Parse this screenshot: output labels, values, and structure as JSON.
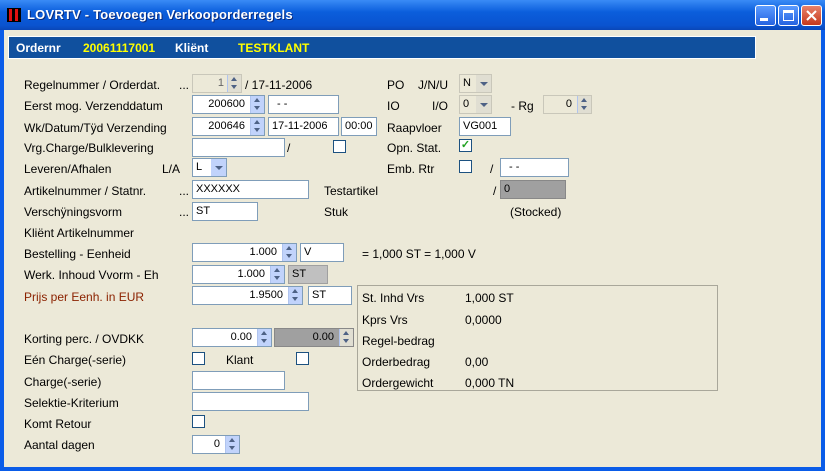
{
  "window": {
    "title": "LOVRTV - Toevoegen Verkooporderregels"
  },
  "header": {
    "ordernr_label": "Ordernr",
    "ordernr_value": "20061117001",
    "client_label": "Kliënt",
    "client_value": "TESTKLANT"
  },
  "fields": {
    "regelnummer": {
      "label": "Regelnummer / Orderdat.",
      "dots": "...",
      "value": "1",
      "date": "/ 17-11-2006"
    },
    "eerst_mog": {
      "label": "Eerst mog. Verzenddatum",
      "value": "200600",
      "date": "- -"
    },
    "wk_datum": {
      "label": "Wk/Datum/Tÿd Verzending",
      "week": "200646",
      "date": "17-11-2006",
      "time": "00:00"
    },
    "vrg_charge": {
      "label": "Vrg.Charge/Bulklevering",
      "value": "",
      "slash": "/"
    },
    "leveren": {
      "label": "Leveren/Afhalen",
      "sub": "L/A",
      "value": "L"
    },
    "artikel": {
      "label": "Artikelnummer / Statnr.",
      "dots": "...",
      "value": "XXXXXX",
      "desc": "Testartikel",
      "slash": "/",
      "statnr": "0"
    },
    "verschijning": {
      "label": "Verschÿningsvorm",
      "dots": "...",
      "value": "ST",
      "unit": "Stuk",
      "stocked": "(Stocked)"
    },
    "klient_art": {
      "label": "Kliënt Artikelnummer"
    },
    "bestelling": {
      "label": "Bestelling - Eenheid",
      "value": "1.000",
      "unit": "V",
      "conv": "= 1,000 ST  = 1,000 V"
    },
    "werk_inhoud": {
      "label": "Werk. Inhoud Vvorm - Eh",
      "value": "1.000",
      "unit": "ST"
    },
    "prijs": {
      "label": "Prijs per Eenh. in EUR",
      "value": "1.9500",
      "unit": "ST"
    },
    "korting": {
      "label": "Korting perc. / OVDKK",
      "value": "0.00",
      "ovdkk": "0.00"
    },
    "een_charge": {
      "label": "Eén Charge(-serie)",
      "klant_label": "Klant"
    },
    "charge_serie": {
      "label": "Charge(-serie)",
      "value": ""
    },
    "selektie": {
      "label": "Selektie-Kriterium",
      "value": ""
    },
    "komt_retour": {
      "label": "Komt Retour"
    },
    "aantal_dagen": {
      "label": "Aantal dagen",
      "value": "0"
    }
  },
  "right": {
    "po": {
      "label": "PO",
      "sub": "J/N/U",
      "value": "N"
    },
    "io": {
      "label": "IO",
      "sub": "I/O",
      "value": "0",
      "rg_label": "- Rg",
      "rg_value": "0"
    },
    "raapvloer": {
      "label": "Raapvloer",
      "value": "VG001"
    },
    "opn_stat": {
      "label": "Opn. Stat.",
      "checked": "✓"
    },
    "emb_rtr": {
      "label": "Emb. Rtr",
      "slash": "/",
      "value": "- -"
    }
  },
  "summary": {
    "st_inhd_label": "St. Inhd Vrs",
    "st_inhd_value": "1,000 ST",
    "kprs_label": "Kprs Vrs",
    "kprs_value": "0,0000",
    "regel_label": "Regel-bedrag",
    "order_label": "Orderbedrag",
    "order_value": "0,00",
    "gewicht_label": "Ordergewicht",
    "gewicht_value": "0,000 TN"
  },
  "colors": {
    "title_bar": "#0A5CE8",
    "header_bg": "#10509E",
    "header_value": "#FFFF00",
    "label_red": "#8B2200"
  }
}
